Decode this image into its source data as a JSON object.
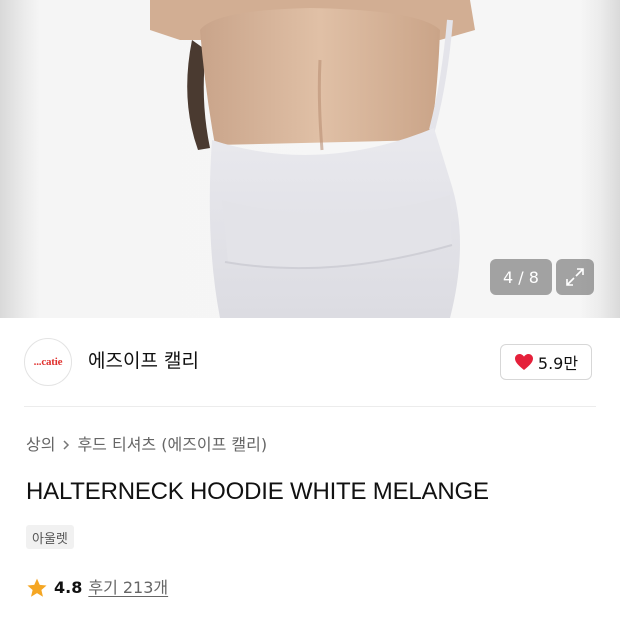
{
  "gallery": {
    "counter": "4 / 8",
    "expand_icon": "expand-arrows-icon"
  },
  "brand": {
    "logo_text": "...catie",
    "name": "에즈이프 캘리",
    "like_icon": "heart-icon",
    "like_count": "5.9만",
    "like_color": "#e5203a"
  },
  "breadcrumb": {
    "category": "상의",
    "separator_icon": "chevron-right-icon",
    "subcategory": "후드 티셔츠 (에즈이프 캘리)"
  },
  "product": {
    "title": "HALTERNECK HOODIE WHITE MELANGE",
    "tag": "아울렛"
  },
  "rating": {
    "star_icon": "star-icon",
    "star_color": "#f5a623",
    "value": "4.8",
    "reviews": "후기 213개"
  }
}
